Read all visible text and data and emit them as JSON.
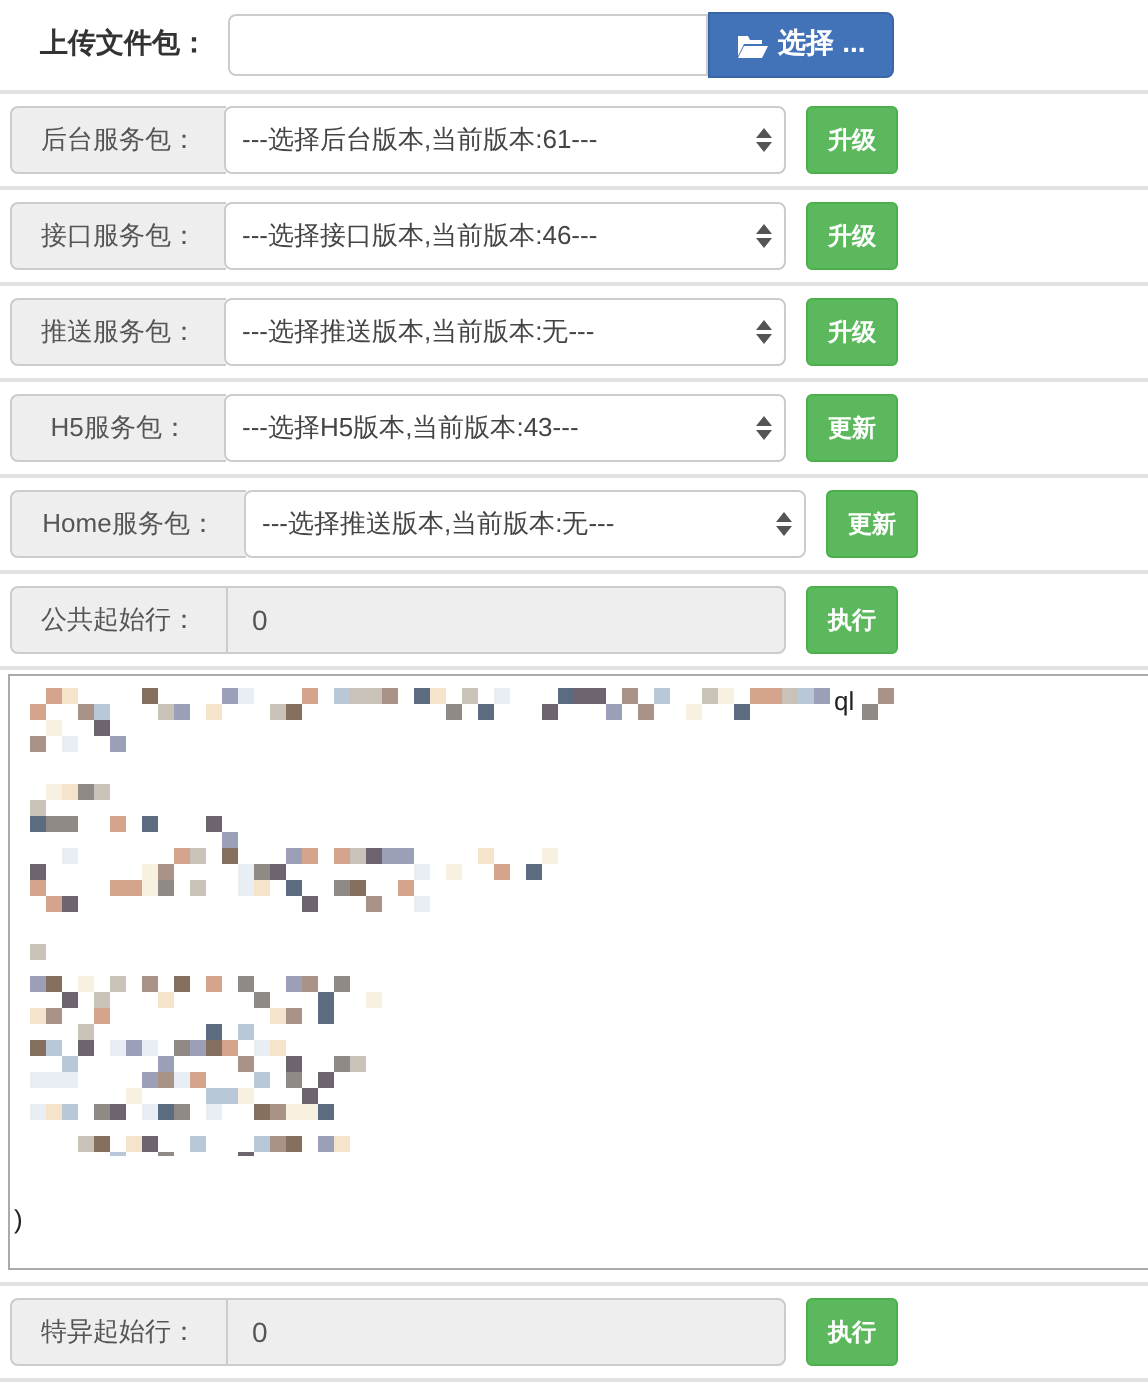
{
  "upload": {
    "label": "上传文件包：",
    "button": "选择 ..."
  },
  "packages": [
    {
      "label": "后台服务包：",
      "select": "---选择后台版本,当前版本:61---",
      "button": "升级",
      "wide": false
    },
    {
      "label": "接口服务包：",
      "select": "---选择接口版本,当前版本:46---",
      "button": "升级",
      "wide": false
    },
    {
      "label": "推送服务包：",
      "select": "---选择推送版本,当前版本:无---",
      "button": "升级",
      "wide": false
    },
    {
      "label": "H5服务包：",
      "select": "---选择H5版本,当前版本:43---",
      "button": "更新",
      "wide": false
    },
    {
      "label": "Home服务包：",
      "select": "---选择推送版本,当前版本:无---",
      "button": "更新",
      "wide": true
    }
  ],
  "public_start": {
    "label": "公共起始行：",
    "value": "0",
    "button": "执行"
  },
  "script_area": {
    "visible_text": [
      "ql",
      ")"
    ]
  },
  "special_start": {
    "label": "特异起始行：",
    "value": "0",
    "button": "执行"
  }
}
